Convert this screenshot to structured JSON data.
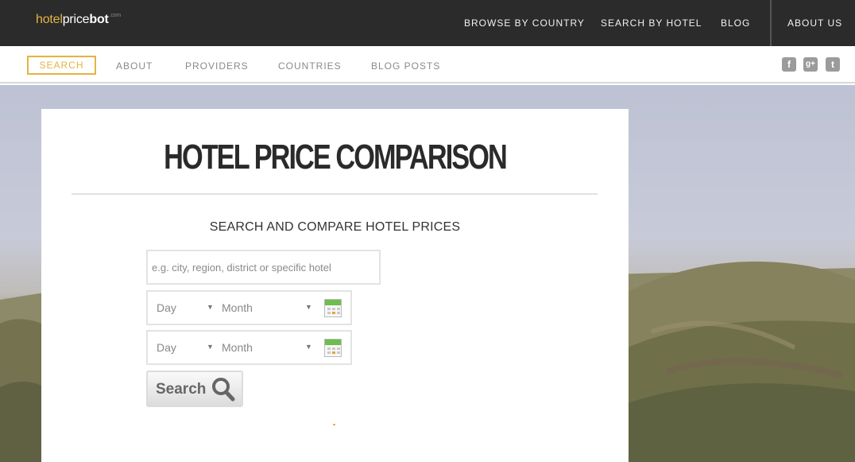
{
  "logo": {
    "part1": "hotel",
    "part2": "price",
    "part3": "bot",
    "suffix": ".com"
  },
  "topnav": [
    "BROWSE BY COUNTRY",
    "SEARCH BY HOTEL",
    "BLOG",
    "ABOUT US"
  ],
  "subnav": [
    "SEARCH",
    "ABOUT",
    "PROVIDERS",
    "COUNTRIES",
    "BLOG POSTS"
  ],
  "social": [
    {
      "icon": "facebook-icon",
      "glyph": "f"
    },
    {
      "icon": "google-plus-icon",
      "glyph": "g+"
    },
    {
      "icon": "twitter-icon",
      "glyph": "t"
    }
  ],
  "main": {
    "title": "HOTEL PRICE COMPARISON",
    "subtitle": "SEARCH AND COMPARE HOTEL PRICES",
    "search_placeholder": "e.g. city, region, district or specific hotel",
    "checkin": {
      "day": "Day",
      "month": "Month"
    },
    "checkout": {
      "day": "Day",
      "month": "Month"
    },
    "search_button": "Search"
  },
  "colors": {
    "accent": "#e3b443",
    "topbar": "#2b2b2b",
    "calendar_green": "#6ebd4d"
  }
}
